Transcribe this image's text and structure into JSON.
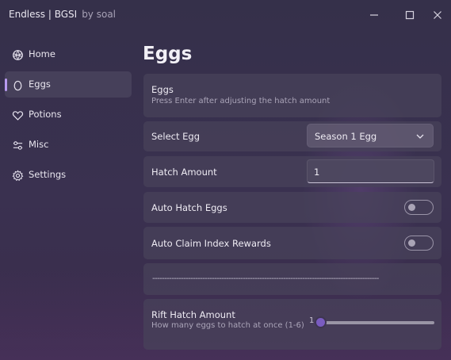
{
  "window": {
    "title": "Endless | BGSI",
    "author": "by soal",
    "controls": {
      "minimize": "minimize-icon",
      "maximize": "maximize-icon",
      "close": "close-icon"
    }
  },
  "sidebar": {
    "items": [
      {
        "label": "Home",
        "icon": "home-icon",
        "active": false
      },
      {
        "label": "Eggs",
        "icon": "egg-icon",
        "active": true
      },
      {
        "label": "Potions",
        "icon": "heart-icon",
        "active": false
      },
      {
        "label": "Misc",
        "icon": "sliders-icon",
        "active": false
      },
      {
        "label": "Settings",
        "icon": "gear-icon",
        "active": false
      }
    ]
  },
  "main": {
    "page_title": "Eggs",
    "section": {
      "title": "Eggs",
      "description": "Press Enter after adjusting the hatch amount"
    },
    "select_egg": {
      "label": "Select Egg",
      "value": "Season 1 Egg"
    },
    "hatch_amount": {
      "label": "Hatch Amount",
      "value": "1"
    },
    "auto_hatch": {
      "label": "Auto Hatch Eggs",
      "enabled": false
    },
    "auto_claim": {
      "label": "Auto Claim Index Rewards",
      "enabled": false
    },
    "divider": {
      "text": "-----------------------------------------------------------------------------------------------"
    },
    "rift_hatch": {
      "label": "Rift Hatch Amount",
      "description": "How many eggs to hatch at once (1-6)",
      "value": "1",
      "min": 1,
      "max": 6
    }
  },
  "colors": {
    "accent": "#b89af0",
    "slider_knob": "#7a5cc0"
  }
}
